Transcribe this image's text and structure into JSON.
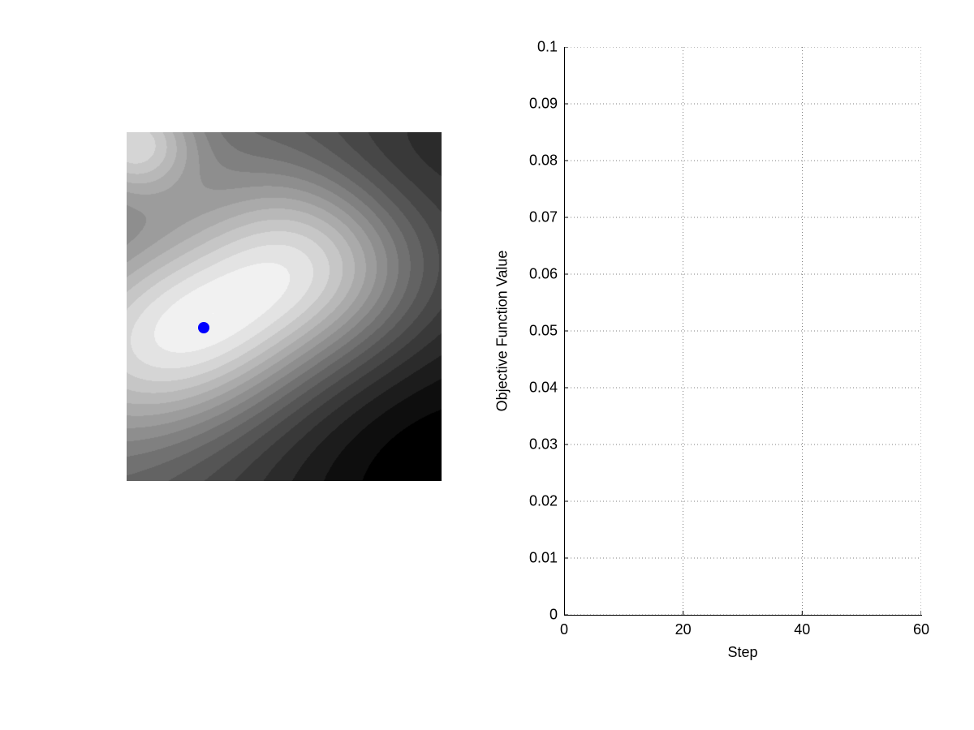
{
  "chart_data": [
    {
      "type": "heatmap",
      "description": "Grayscale contour/heatmap of a 2D objective function surface with banded levels.",
      "marker": {
        "x_frac": 0.245,
        "y_frac": 0.56,
        "color": "#0000ff"
      },
      "colormap": "gray",
      "bright_regions": [
        "upper-left corner (local peak)",
        "center-left broad basin (global peak)"
      ],
      "dark_regions": [
        "bottom-right corner",
        "top-right edge"
      ]
    },
    {
      "type": "line",
      "title": "",
      "xlabel": "Step",
      "ylabel": "Objective Function Value",
      "xlim": [
        0,
        60
      ],
      "ylim": [
        0,
        0.1
      ],
      "xticks": [
        0,
        20,
        40,
        60
      ],
      "yticks": [
        0,
        0.01,
        0.02,
        0.03,
        0.04,
        0.05,
        0.06,
        0.07,
        0.08,
        0.09,
        0.1
      ],
      "series": [],
      "grid": true
    }
  ],
  "marker_color": "#0000ff",
  "labels": {
    "xlabel": "Step",
    "ylabel": "Objective Function Value",
    "xticks": [
      "0",
      "20",
      "40",
      "60"
    ],
    "yticks": [
      "0",
      "0.01",
      "0.02",
      "0.03",
      "0.04",
      "0.05",
      "0.06",
      "0.07",
      "0.08",
      "0.09",
      "0.1"
    ]
  }
}
